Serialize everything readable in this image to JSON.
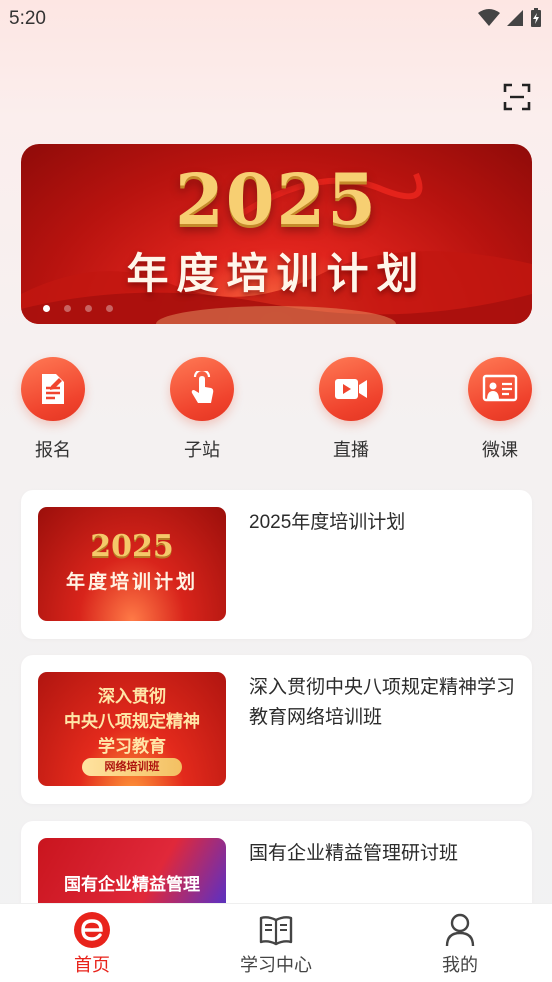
{
  "status_bar": {
    "time": "5:20"
  },
  "banner": {
    "year": "2025",
    "title": "年度培训计划",
    "dots": 4,
    "active_dot": 0
  },
  "quick_nav": [
    {
      "label": "报名",
      "icon": "signup-doc-icon"
    },
    {
      "label": "子站",
      "icon": "tap-hand-icon"
    },
    {
      "label": "直播",
      "icon": "video-camera-icon"
    },
    {
      "label": "微课",
      "icon": "mini-lesson-icon"
    }
  ],
  "courses": [
    {
      "title": "2025年度培训计划",
      "thumb_year": "2025",
      "thumb_sub": "年度培训计划"
    },
    {
      "title": "深入贯彻中央八项规定精神学习教育网络培训班",
      "thumb_lines": [
        "深入贯彻",
        "中央八项规定精神",
        "学习教育"
      ],
      "thumb_tag": "网络培训班"
    },
    {
      "title": "国有企业精益管理研讨班",
      "thumb_text": "国有企业精益管理"
    }
  ],
  "tabbar": [
    {
      "label": "首页",
      "icon": "home-e-logo-icon",
      "active": true
    },
    {
      "label": "学习中心",
      "icon": "open-book-icon",
      "active": false
    },
    {
      "label": "我的",
      "icon": "user-icon",
      "active": false
    }
  ],
  "colors": {
    "accent": "#e8231b",
    "icon_gradient_start": "#ff7a55",
    "icon_gradient_end": "#e33522"
  }
}
